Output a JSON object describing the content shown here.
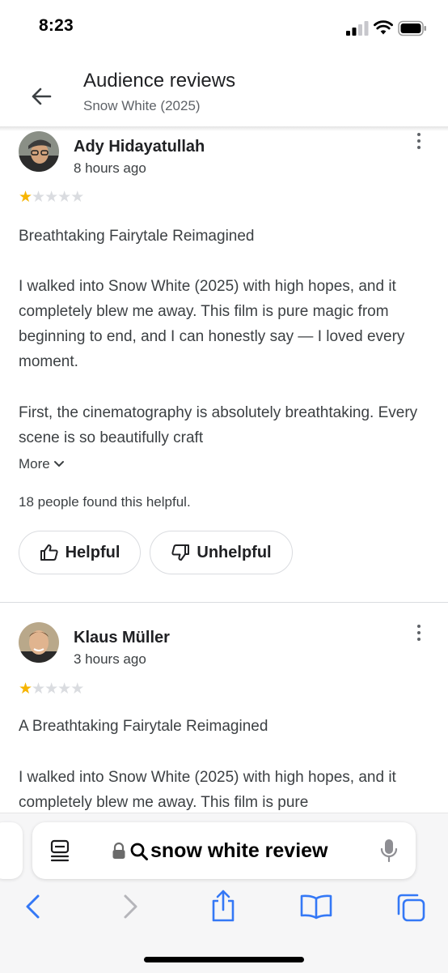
{
  "status_bar": {
    "time": "8:23"
  },
  "header": {
    "title": "Audience reviews",
    "subtitle": "Snow White (2025)"
  },
  "reviews": [
    {
      "author": "Ady Hidayatullah",
      "time": "8 hours ago",
      "rating": 1,
      "max_rating": 5,
      "title": "Breathtaking Fairytale Reimagined",
      "paragraph1": "I walked into Snow White (2025) with high hopes, and it completely blew me away. This film is pure magic from beginning to end, and I can honestly say — I loved every moment.",
      "paragraph2": "First, the cinematography is absolutely breathtaking. Every scene is so beautifully craft",
      "more_label": "More",
      "helpful_count_text": "18 people found this helpful.",
      "helpful_label": "Helpful",
      "unhelpful_label": "Unhelpful"
    },
    {
      "author": "Klaus Müller",
      "time": "3 hours ago",
      "rating": 1,
      "max_rating": 5,
      "title": "A Breathtaking Fairytale Reimagined",
      "paragraph1": "I walked into Snow White (2025) with high hopes, and it completely blew me away. This film is pure"
    }
  ],
  "safari": {
    "url_text": "snow white review"
  },
  "colors": {
    "star_on": "#f6b400",
    "star_off": "#dadce0",
    "safari_accent": "#3478f6"
  },
  "icons": [
    "back-arrow-icon",
    "kebab-menu-icon",
    "star-icon",
    "thumbs-up-icon",
    "thumbs-down-icon",
    "tabs-list-icon",
    "lock-icon",
    "search-icon",
    "microphone-icon",
    "back-chevron-icon",
    "forward-chevron-icon",
    "share-icon",
    "bookmarks-icon",
    "tabs-icon"
  ]
}
